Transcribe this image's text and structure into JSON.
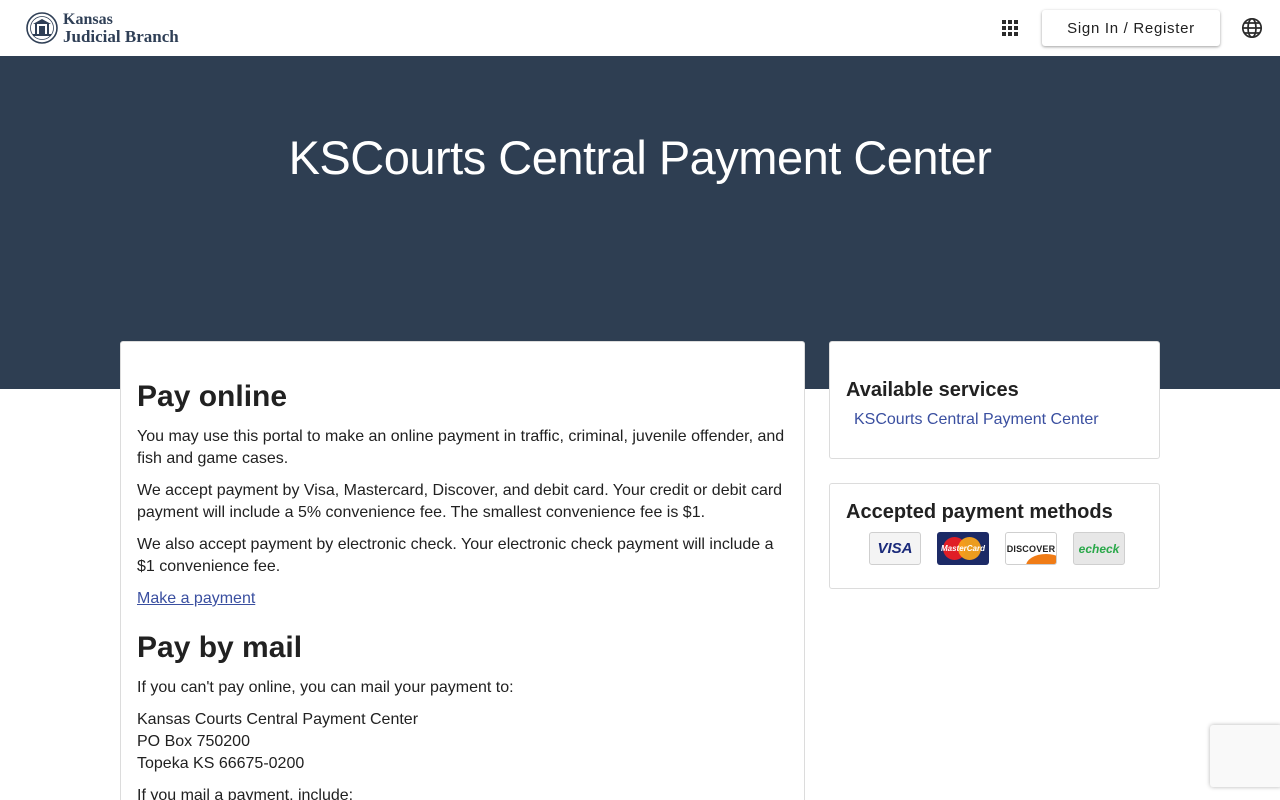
{
  "header": {
    "brand_line1": "Kansas",
    "brand_line2": "Judicial Branch",
    "apps_icon": "grid-apps-icon",
    "signin_label": "Sign In / Register",
    "language_icon": "globe-icon"
  },
  "hero": {
    "title": "KSCourts Central Payment Center",
    "background_color": "#2e3e52"
  },
  "main": {
    "pay_online_title": "Pay online",
    "pay_online_p1": "You may use this portal to make an online payment in traffic, criminal, juvenile offender, and fish and game cases.",
    "pay_online_p2": "We accept payment by Visa, Mastercard, Discover, and debit card. Your credit or debit card payment will include a 5% convenience fee. The smallest convenience fee is $1.",
    "pay_online_p3": "We also accept payment by electronic check. Your electronic check payment will include a $1 convenience fee.",
    "make_payment_link": "Make a payment",
    "pay_mail_title": "Pay by mail",
    "pay_mail_p1": "If you can't pay online, you can mail your payment to:",
    "address": {
      "line1": "Kansas Courts Central Payment Center",
      "line2": "PO Box 750200",
      "line3": "Topeka KS 66675-0200"
    },
    "pay_mail_p2": "If you mail a payment, include:"
  },
  "sidebar": {
    "services_title": "Available services",
    "services_link": "KSCourts Central Payment Center",
    "methods_title": "Accepted payment methods",
    "methods": [
      {
        "name": "visa",
        "label": "VISA"
      },
      {
        "name": "mastercard",
        "label": "MasterCard"
      },
      {
        "name": "discover",
        "label": "DISCOVER"
      },
      {
        "name": "echeck",
        "label": "echeck"
      }
    ]
  },
  "colors": {
    "link": "#3a4fa0",
    "brand_text": "#2f3f56"
  }
}
